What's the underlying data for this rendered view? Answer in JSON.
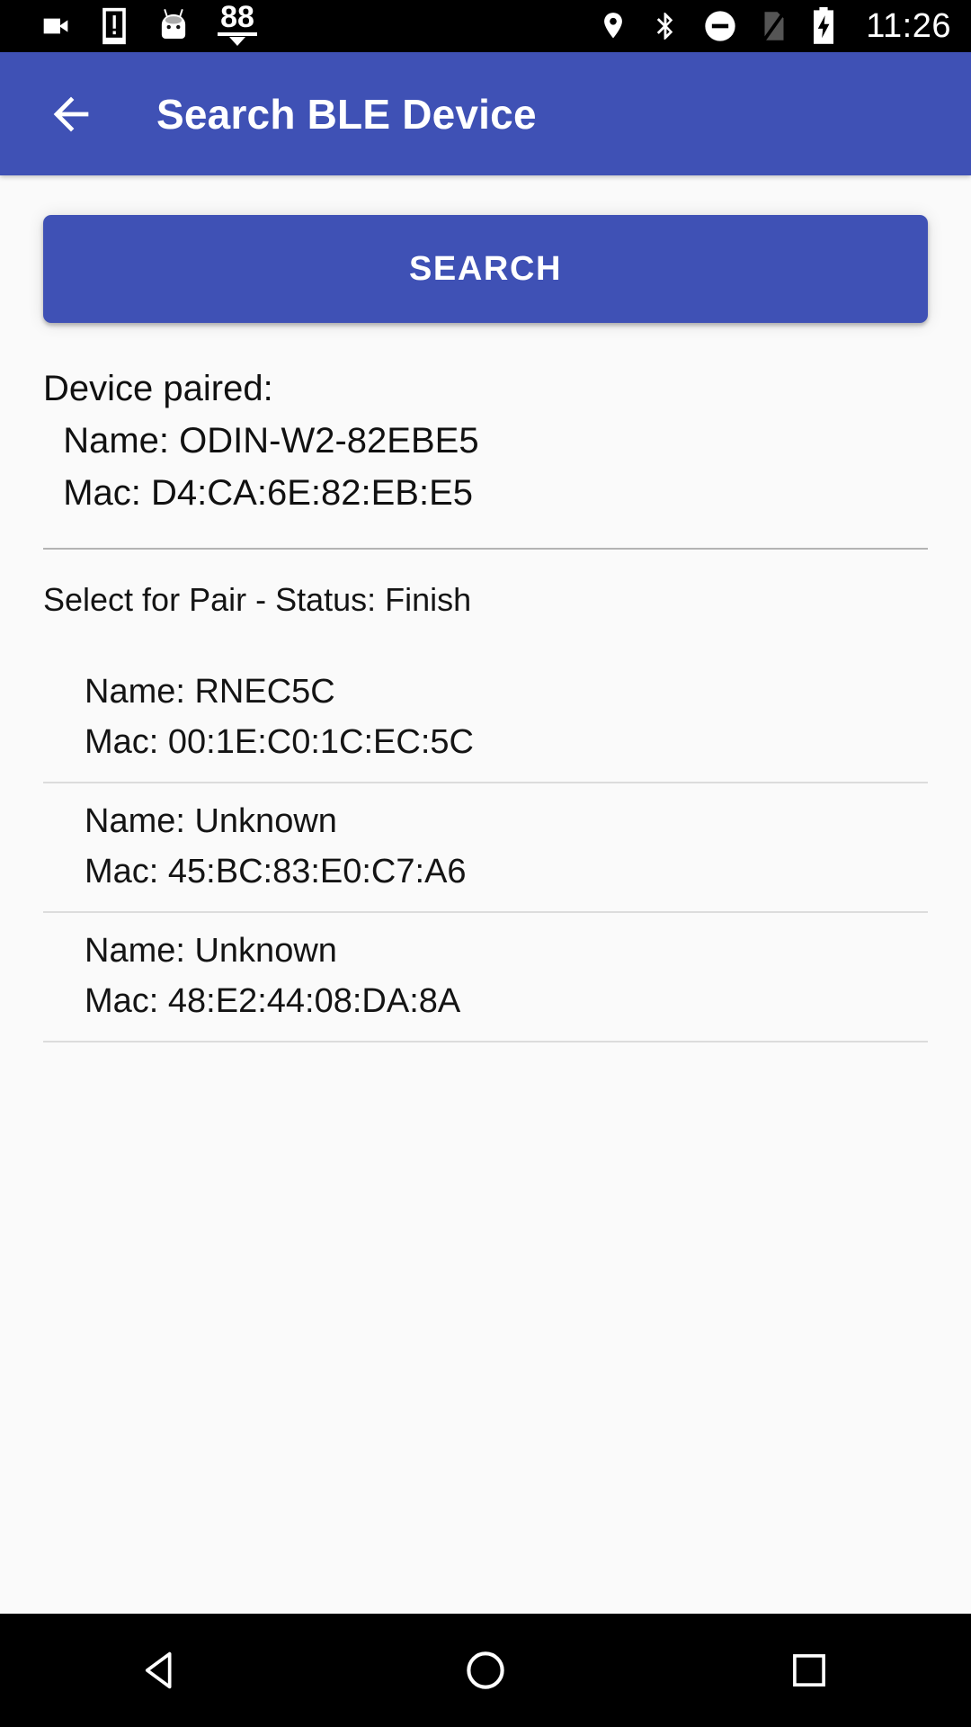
{
  "status_bar": {
    "time": "11:26",
    "battery_badge": "88",
    "left_icons": [
      {
        "name": "video-camera-icon"
      },
      {
        "name": "device-alert-icon"
      },
      {
        "name": "android-head-icon"
      },
      {
        "name": "battery-level-88-icon"
      }
    ],
    "right_icons": [
      {
        "name": "location-pin-icon"
      },
      {
        "name": "bluetooth-icon"
      },
      {
        "name": "do-not-disturb-icon"
      },
      {
        "name": "no-sim-card-icon"
      },
      {
        "name": "battery-charging-icon"
      }
    ]
  },
  "app_bar": {
    "back_label": "Back",
    "title": "Search BLE Device"
  },
  "main": {
    "search_button_label": "SEARCH",
    "paired": {
      "heading": "Device paired:",
      "name_line": "  Name: ODIN-W2-82EBE5",
      "mac_line": "  Mac: D4:CA:6E:82:EB:E5"
    },
    "select_status_line": "Select for Pair - Status: Finish",
    "devices": [
      {
        "name_line": "Name: RNEC5C",
        "mac_line": "Mac: 00:1E:C0:1C:EC:5C"
      },
      {
        "name_line": "Name: Unknown",
        "mac_line": "Mac: 45:BC:83:E0:C7:A6"
      },
      {
        "name_line": "Name: Unknown",
        "mac_line": "Mac: 48:E2:44:08:DA:8A"
      }
    ]
  },
  "nav_bar": {
    "back": "back-nav",
    "home": "home-nav",
    "recents": "recents-nav"
  },
  "colors": {
    "primary": "#3f51b5",
    "status_bar_bg": "#000000",
    "page_bg": "#fafafa",
    "divider": "#b3b3b3"
  }
}
